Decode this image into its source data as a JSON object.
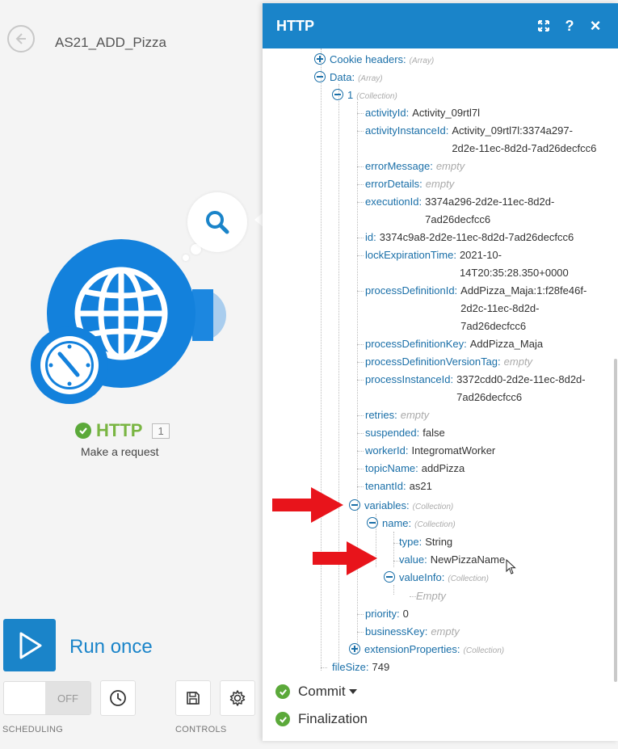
{
  "scenario": {
    "title": "AS21_ADD_Pizza"
  },
  "module": {
    "name": "HTTP",
    "index": "1",
    "action": "Make a request"
  },
  "controls": {
    "run_label": "Run once",
    "toggle_label": "OFF",
    "scheduling_caption": "SCHEDULING",
    "controls_caption": "CONTROLS"
  },
  "panel": {
    "title": "HTTP",
    "help_label": "?",
    "close_label": "×",
    "status_items": [
      {
        "label": "Commit",
        "has_dropdown": true
      },
      {
        "label": "Finalization",
        "has_dropdown": false
      }
    ]
  },
  "tree": {
    "cookie_headers": {
      "key": "Cookie headers:",
      "type": "(Array)"
    },
    "data": {
      "key": "Data:",
      "type": "(Array)"
    },
    "item1": {
      "key": "1",
      "type": "(Collection)"
    },
    "fields": [
      {
        "key": "activityId:",
        "lines": [
          "Activity_09rtl7l"
        ]
      },
      {
        "key": "activityInstanceId:",
        "lines": [
          "Activity_09rtl7l:3374a297-",
          "2d2e-11ec-8d2d-7ad26decfcc6"
        ]
      },
      {
        "key": "errorMessage:",
        "empty": "empty"
      },
      {
        "key": "errorDetails:",
        "empty": "empty"
      },
      {
        "key": "executionId:",
        "lines": [
          "3374a296-2d2e-11ec-8d2d-",
          "7ad26decfcc6"
        ]
      },
      {
        "key": "id:",
        "lines": [
          "3374c9a8-2d2e-11ec-8d2d-7ad26decfcc6"
        ]
      },
      {
        "key": "lockExpirationTime:",
        "lines": [
          "2021-10-",
          "14T20:35:28.350+0000"
        ]
      },
      {
        "key": "processDefinitionId:",
        "lines": [
          "AddPizza_Maja:1:f28fe46f-",
          "2d2c-11ec-8d2d-",
          "7ad26decfcc6"
        ]
      },
      {
        "key": "processDefinitionKey:",
        "lines": [
          "AddPizza_Maja"
        ]
      },
      {
        "key": "processDefinitionVersionTag:",
        "empty": "empty"
      },
      {
        "key": "processInstanceId:",
        "lines": [
          "3372cdd0-2d2e-11ec-8d2d-",
          "7ad26decfcc6"
        ]
      },
      {
        "key": "retries:",
        "empty": "empty"
      },
      {
        "key": "suspended:",
        "lines": [
          "false"
        ]
      },
      {
        "key": "workerId:",
        "lines": [
          "IntegromatWorker"
        ]
      },
      {
        "key": "topicName:",
        "lines": [
          "addPizza"
        ]
      },
      {
        "key": "tenantId:",
        "lines": [
          "as21"
        ]
      }
    ],
    "variables": {
      "key": "variables:",
      "type": "(Collection)"
    },
    "name": {
      "key": "name:",
      "type": "(Collection)"
    },
    "var_type": {
      "key": "type:",
      "value": "String"
    },
    "var_value": {
      "key": "value:",
      "value": "NewPizzaName"
    },
    "value_info": {
      "key": "valueInfo:",
      "type": "(Collection)"
    },
    "value_info_empty": "Empty",
    "priority": {
      "key": "priority:",
      "value": "0"
    },
    "business_key": {
      "key": "businessKey:",
      "empty": "empty"
    },
    "extension_properties": {
      "key": "extensionProperties:",
      "type": "(Collection)"
    },
    "file_size": {
      "key": "fileSize:",
      "value": "749"
    }
  },
  "colors": {
    "accent": "#1a84c9",
    "success": "#5ba93a",
    "arrow": "#e8141b"
  }
}
